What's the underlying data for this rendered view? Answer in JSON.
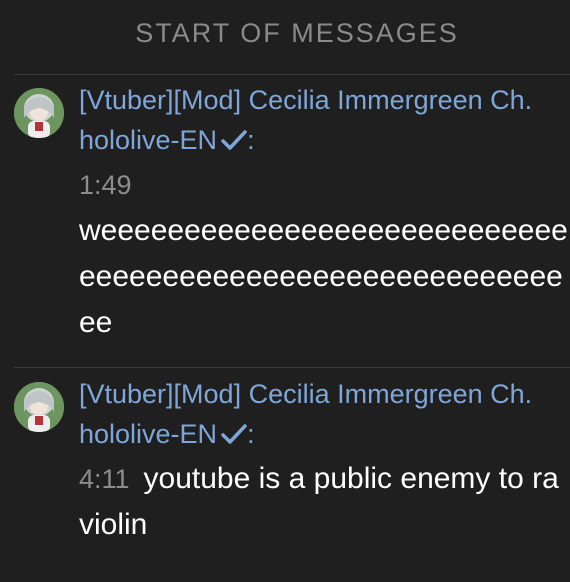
{
  "header": {
    "title": "START OF MESSAGES"
  },
  "messages": [
    {
      "author": "[Vtuber][Mod] Cecilia Immergreen Ch. hololive-EN",
      "verified_icon": "checkmark-icon",
      "separator": ":",
      "time": "1:49",
      "text": "weeeeeeeeeeeeeeeeeeeeeeeeeeeeeeeeeeeeeeeeeeeeeeeeeeeeeeeeeee"
    },
    {
      "author": "[Vtuber][Mod] Cecilia Immergreen Ch. hololive-EN",
      "verified_icon": "checkmark-icon",
      "separator": ":",
      "time": "4:11",
      "text": "youtube is a public enemy to raviolin"
    }
  ],
  "colors": {
    "background": "#1f1f1f",
    "author": "#7ea6d8",
    "timestamp": "#8d8d8d",
    "message_text": "#ffffff",
    "header_text": "#8a8a8a"
  }
}
